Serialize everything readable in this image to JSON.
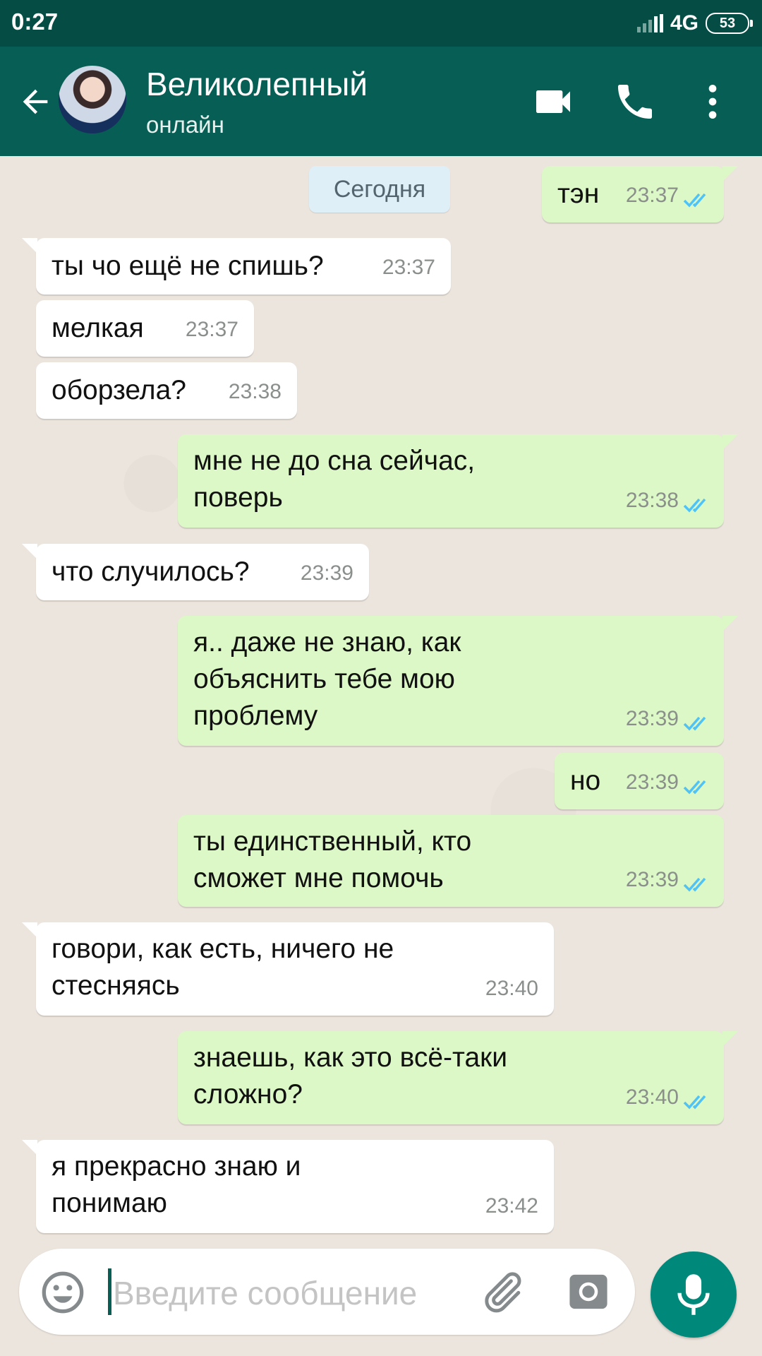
{
  "status_bar": {
    "time": "0:27",
    "network": "4G",
    "battery": "53"
  },
  "header": {
    "name": "Великолепный",
    "status": "онлайн"
  },
  "chat": {
    "date": "Сегодня",
    "messages": [
      {
        "dir": "out",
        "text": "тэн",
        "time": "23:37"
      },
      {
        "dir": "in",
        "text": "ты чо ещё не спишь?",
        "time": "23:37"
      },
      {
        "dir": "in",
        "text": "мелкая",
        "time": "23:37"
      },
      {
        "dir": "in",
        "text": "оборзела?",
        "time": "23:38"
      },
      {
        "dir": "out",
        "text": "мне не до сна сейчас,",
        "text2": "поверь",
        "time": "23:38"
      },
      {
        "dir": "in",
        "text": "что случилось?",
        "time": "23:39"
      },
      {
        "dir": "out",
        "text": "я.. даже не знаю, как",
        "text2": "объяснить тебе мою",
        "text3": "проблему",
        "time": "23:39"
      },
      {
        "dir": "out",
        "text": "но",
        "time": "23:39"
      },
      {
        "dir": "out",
        "text": "ты единственный, кто",
        "text2": "сможет мне помочь",
        "time": "23:39"
      },
      {
        "dir": "in",
        "text": "говори, как есть, ничего не",
        "text2": "стесняясь",
        "time": "23:40"
      },
      {
        "dir": "out",
        "text": "знаешь, как это всё-таки",
        "text2": "сложно?",
        "time": "23:40"
      },
      {
        "dir": "in",
        "text": "я прекрасно знаю и",
        "text2": "понимаю",
        "time": "23:42"
      }
    ]
  },
  "composer": {
    "placeholder": "Введите сообщение"
  },
  "colors": {
    "header": "#075e54",
    "outgoing": "#dcf8c6",
    "accent": "#00897b",
    "tick": "#4fc3f7"
  },
  "icons": [
    "back-arrow-icon",
    "video-call-icon",
    "phone-icon",
    "more-vert-icon",
    "emoji-icon",
    "attach-icon",
    "camera-icon",
    "mic-icon",
    "read-ticks-icon"
  ]
}
